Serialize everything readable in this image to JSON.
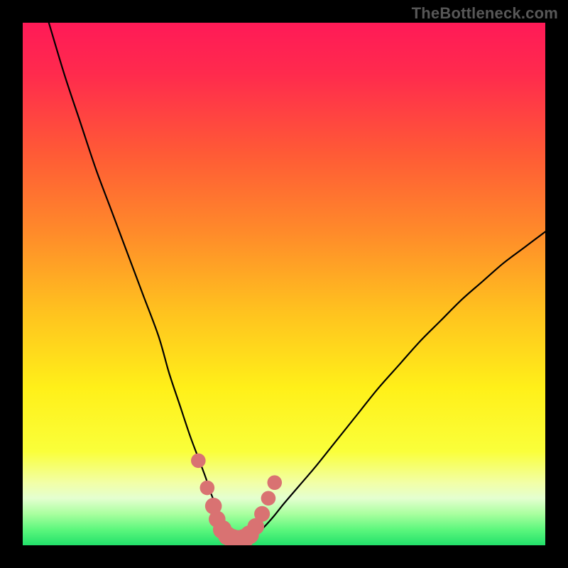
{
  "watermark": "TheBottleneck.com",
  "colors": {
    "gradient_stops": [
      {
        "offset": 0.0,
        "color": "#ff1a57"
      },
      {
        "offset": 0.1,
        "color": "#ff2b4d"
      },
      {
        "offset": 0.25,
        "color": "#ff5a36"
      },
      {
        "offset": 0.4,
        "color": "#ff8a2a"
      },
      {
        "offset": 0.55,
        "color": "#ffc11f"
      },
      {
        "offset": 0.7,
        "color": "#fff019"
      },
      {
        "offset": 0.82,
        "color": "#faff3a"
      },
      {
        "offset": 0.88,
        "color": "#f2ffa6"
      },
      {
        "offset": 0.91,
        "color": "#e4ffd0"
      },
      {
        "offset": 0.94,
        "color": "#a9ff9f"
      },
      {
        "offset": 0.97,
        "color": "#5cf77d"
      },
      {
        "offset": 1.0,
        "color": "#22e06a"
      }
    ],
    "curve": "#000000",
    "marker_fill": "#d97272",
    "marker_stroke": "#d97272"
  },
  "chart_data": {
    "type": "line",
    "title": "",
    "xlabel": "",
    "ylabel": "",
    "xlim": [
      0,
      100
    ],
    "ylim": [
      0,
      100
    ],
    "legend": false,
    "grid": false,
    "series": [
      {
        "name": "bottleneck-curve",
        "x": [
          5,
          8,
          11,
          14,
          17,
          20,
          23,
          26,
          28,
          30,
          32,
          33.5,
          35,
          36,
          37,
          37.8,
          38.5,
          39.3,
          40,
          41,
          42,
          43,
          44.5,
          46,
          48,
          50,
          53,
          56,
          60,
          64,
          68,
          72,
          76,
          80,
          84,
          88,
          92,
          96,
          100
        ],
        "y": [
          100,
          90,
          81,
          72,
          64,
          56,
          48,
          40,
          33,
          27,
          21,
          17,
          13,
          10,
          7.5,
          5.5,
          4,
          2.8,
          2,
          1.3,
          1,
          1.2,
          2,
          3.3,
          5.5,
          8,
          11.5,
          15,
          20,
          25,
          30,
          34.5,
          39,
          43,
          47,
          50.5,
          54,
          57,
          60
        ]
      }
    ],
    "markers": [
      {
        "x": 33.6,
        "y": 16.2,
        "r": 1.4
      },
      {
        "x": 35.3,
        "y": 11.0,
        "r": 1.4
      },
      {
        "x": 36.5,
        "y": 7.5,
        "r": 1.6
      },
      {
        "x": 37.2,
        "y": 5.0,
        "r": 1.6
      },
      {
        "x": 38.2,
        "y": 3.0,
        "r": 1.8
      },
      {
        "x": 39.2,
        "y": 1.8,
        "r": 1.8
      },
      {
        "x": 40.2,
        "y": 1.2,
        "r": 1.9
      },
      {
        "x": 41.2,
        "y": 1.0,
        "r": 1.9
      },
      {
        "x": 42.3,
        "y": 1.2,
        "r": 1.9
      },
      {
        "x": 43.4,
        "y": 2.0,
        "r": 1.8
      },
      {
        "x": 44.6,
        "y": 3.6,
        "r": 1.6
      },
      {
        "x": 45.8,
        "y": 6.0,
        "r": 1.5
      },
      {
        "x": 47.0,
        "y": 9.0,
        "r": 1.4
      },
      {
        "x": 48.2,
        "y": 12.0,
        "r": 1.4
      }
    ]
  }
}
